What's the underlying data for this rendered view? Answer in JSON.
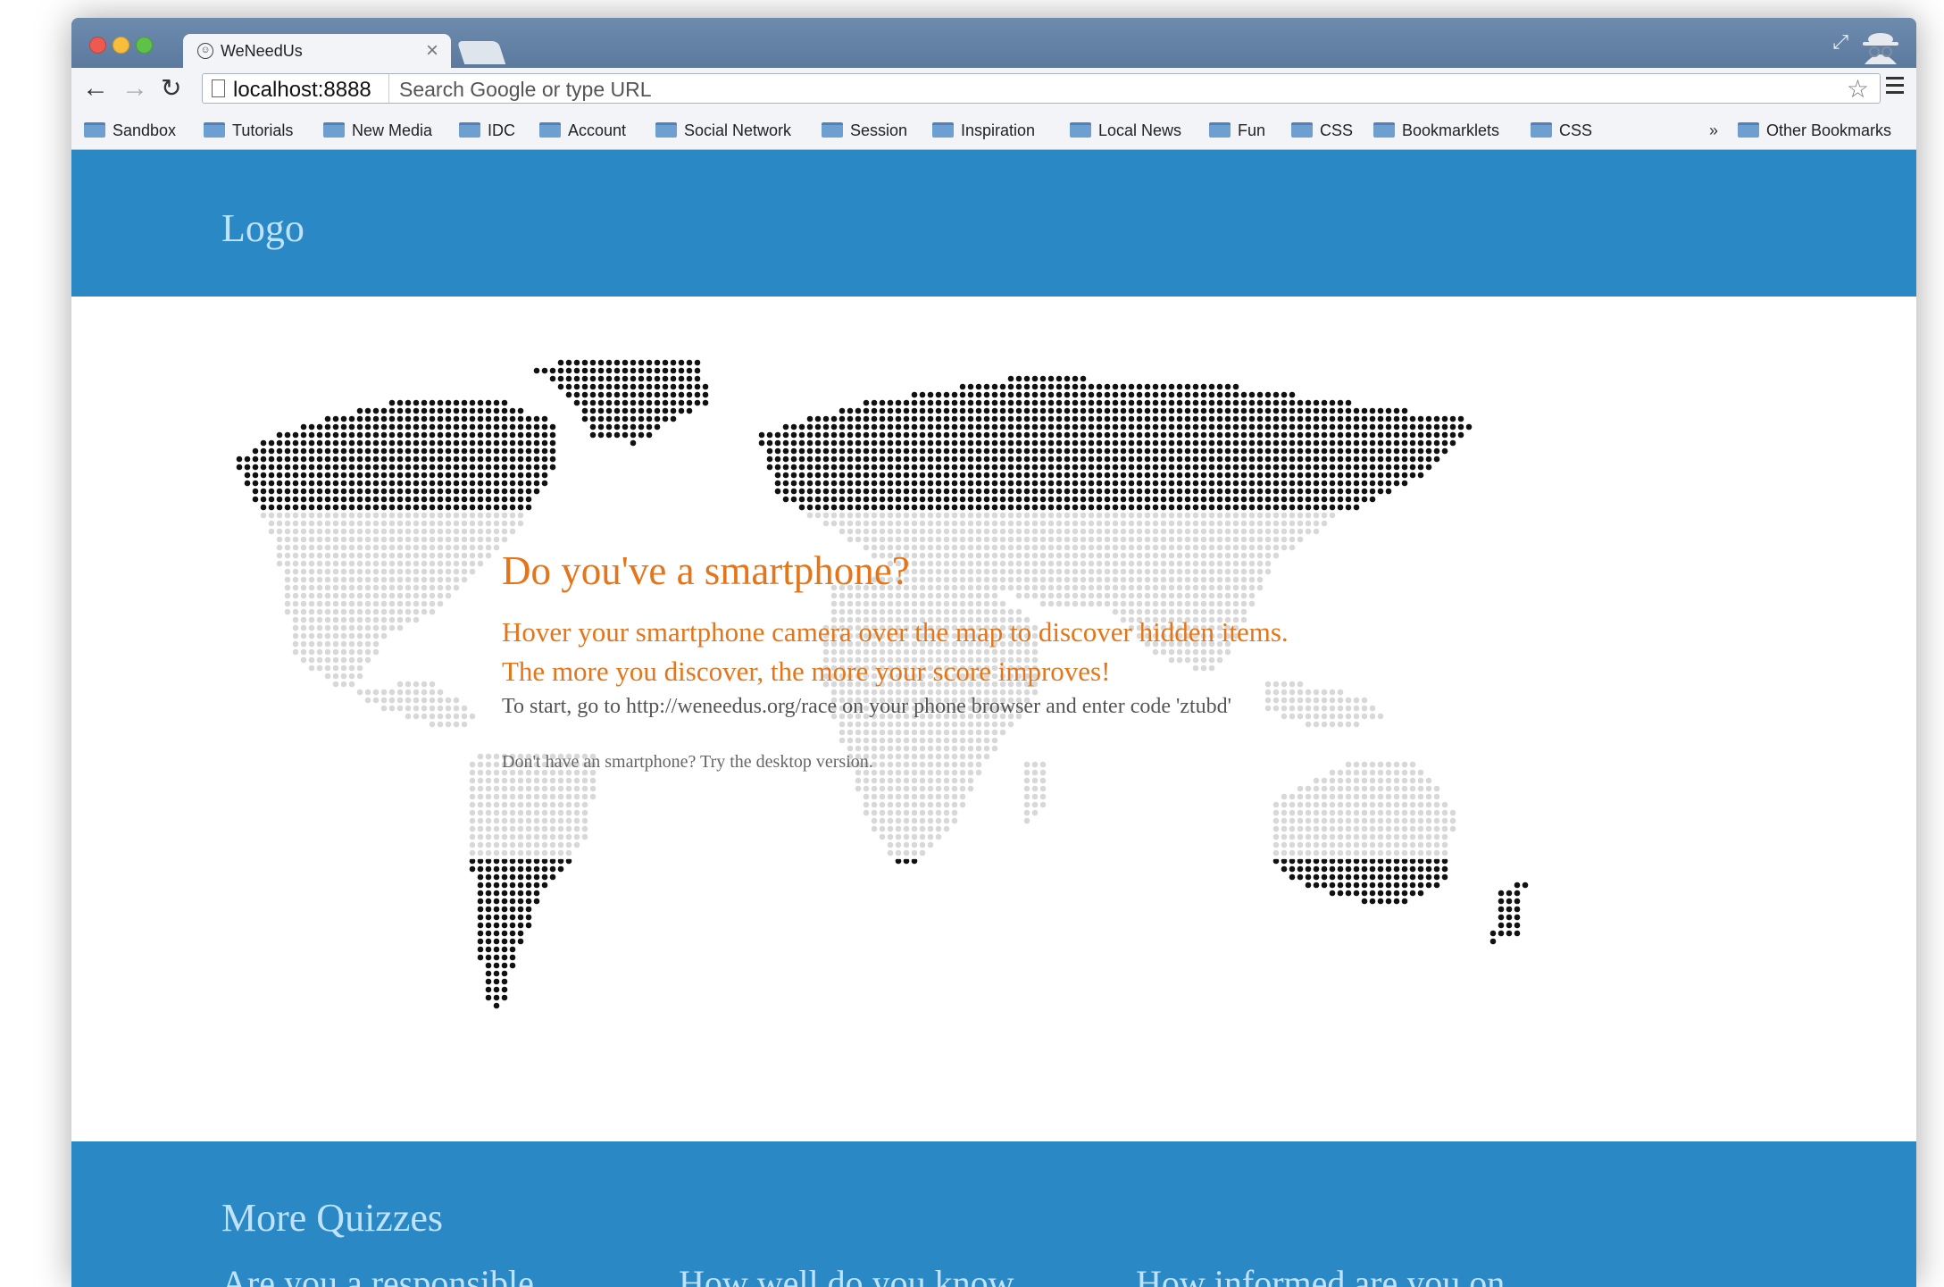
{
  "tab": {
    "title": "WeNeedUs",
    "close": "×"
  },
  "toolbar": {
    "host": "localhost:8888",
    "omnibox_placeholder": "Search Google or type URL"
  },
  "bookmarks": {
    "items": [
      "Sandbox",
      "Tutorials",
      "New Media",
      "IDC",
      "Account",
      "Social Network",
      "Session",
      "Inspiration",
      "Local News",
      "Fun",
      "CSS",
      "Bookmarklets",
      "CSS"
    ],
    "chevron": "»",
    "other": "Other Bookmarks"
  },
  "page": {
    "logo": "Logo",
    "headline": "Do you've a smartphone?",
    "lead1": "Hover your smartphone camera over the map to discover hidden items.",
    "lead2": "The more you discover, the more your score improves!",
    "instruction": "To start, go to http://weneedus.org/race on your phone browser and enter code 'ztubd'",
    "alt_link": "Don't have an smartphone? Try the desktop version.",
    "more_title": "More Quizzes",
    "quizzes": [
      "Are you a responsible",
      "How well do you know",
      "How informed are you on"
    ]
  },
  "colors": {
    "header_blue": "#2a89c4",
    "accent_orange": "#e5751a",
    "logo_text": "#bfe3ff"
  }
}
